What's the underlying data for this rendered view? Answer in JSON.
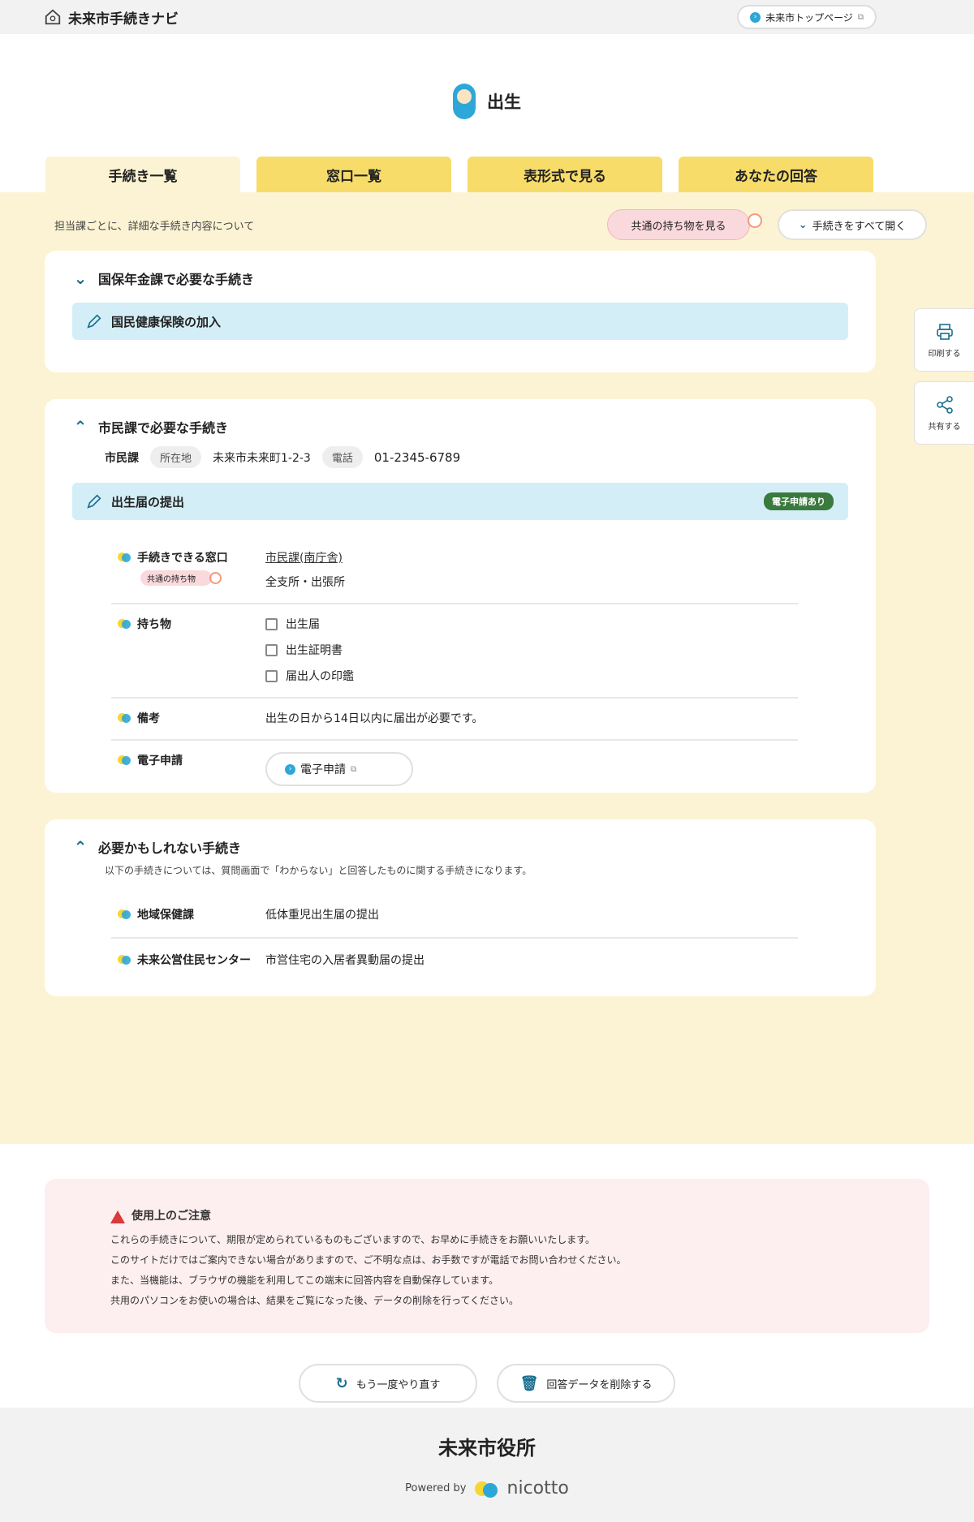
{
  "header": {
    "brand": "未来市手続きナビ",
    "top_link": "未来市トップページ"
  },
  "page": {
    "title": "出生"
  },
  "tabs": [
    {
      "label": "手続き一覧"
    },
    {
      "label": "窓口一覧"
    },
    {
      "label": "表形式で見る"
    },
    {
      "label": "あなたの回答"
    }
  ],
  "main": {
    "lead": "担当課ごとに、詳細な手続き内容について",
    "common_items_button": "共通の持ち物を見る",
    "expand_all_button": "手続きをすべて開く"
  },
  "sections": [
    {
      "title": "国保年金課で必要な手続き",
      "procedure": "国民健康保険の加入"
    },
    {
      "title": "市民課で必要な手続き",
      "dept": "市民課",
      "address_label": "所在地",
      "address": "未来市未来町1-2-3",
      "phone_label": "電話",
      "phone": "01-2345-6789",
      "procedure": "出生届の提出",
      "e_badge": "電子申請あり",
      "rows": {
        "window_label": "手続きできる窓口",
        "window_tag": "共通の持ち物",
        "window_link": "市民課(南庁舎)",
        "window_sub": "全支所・出張所",
        "items_label": "持ち物",
        "items": [
          "出生届",
          "出生証明書",
          "届出人の印鑑"
        ],
        "note_label": "備考",
        "note": "出生の日から14日以内に届出が必要です。",
        "e_label": "電子申請",
        "e_button": "電子申請"
      }
    },
    {
      "title": "必要かもしれない手続き",
      "desc": "以下の手続きについては、質問画面で「わからない」と回答したものに関する手続きになります。",
      "items": [
        {
          "dept": "地域保健課",
          "proc": "低体重児出生届の提出"
        },
        {
          "dept": "未来公営住民センター",
          "proc": "市営住宅の入居者異動届の提出"
        }
      ]
    }
  ],
  "notice": {
    "title": "使用上のご注意",
    "lines": [
      "これらの手続きについて、期限が定められているものもございますので、お早めに手続きをお願いいたします。",
      "このサイトだけではご案内できない場合がありますので、ご不明な点は、お手数ですが電話でお問い合わせください。",
      "また、当機能は、ブラウザの機能を利用してこの端末に回答内容を自動保存しています。",
      "共用のパソコンをお使いの場合は、結果をご覧になった後、データの削除を行ってください。"
    ]
  },
  "buttons": {
    "restart": "もう一度やり直す",
    "delete": "回答データを削除する"
  },
  "side": {
    "print": "印刷する",
    "share": "共有する"
  },
  "footer": {
    "org": "未来市役所",
    "powered": "Powered by",
    "logo": "nicotto"
  },
  "colors": {
    "accent_blue": "#2da7d8",
    "tab_yellow": "#f7dc6a",
    "bg_cream": "#fcf3d4",
    "proc_bar": "#d4eef7",
    "e_badge_green": "#3a7a3e"
  }
}
